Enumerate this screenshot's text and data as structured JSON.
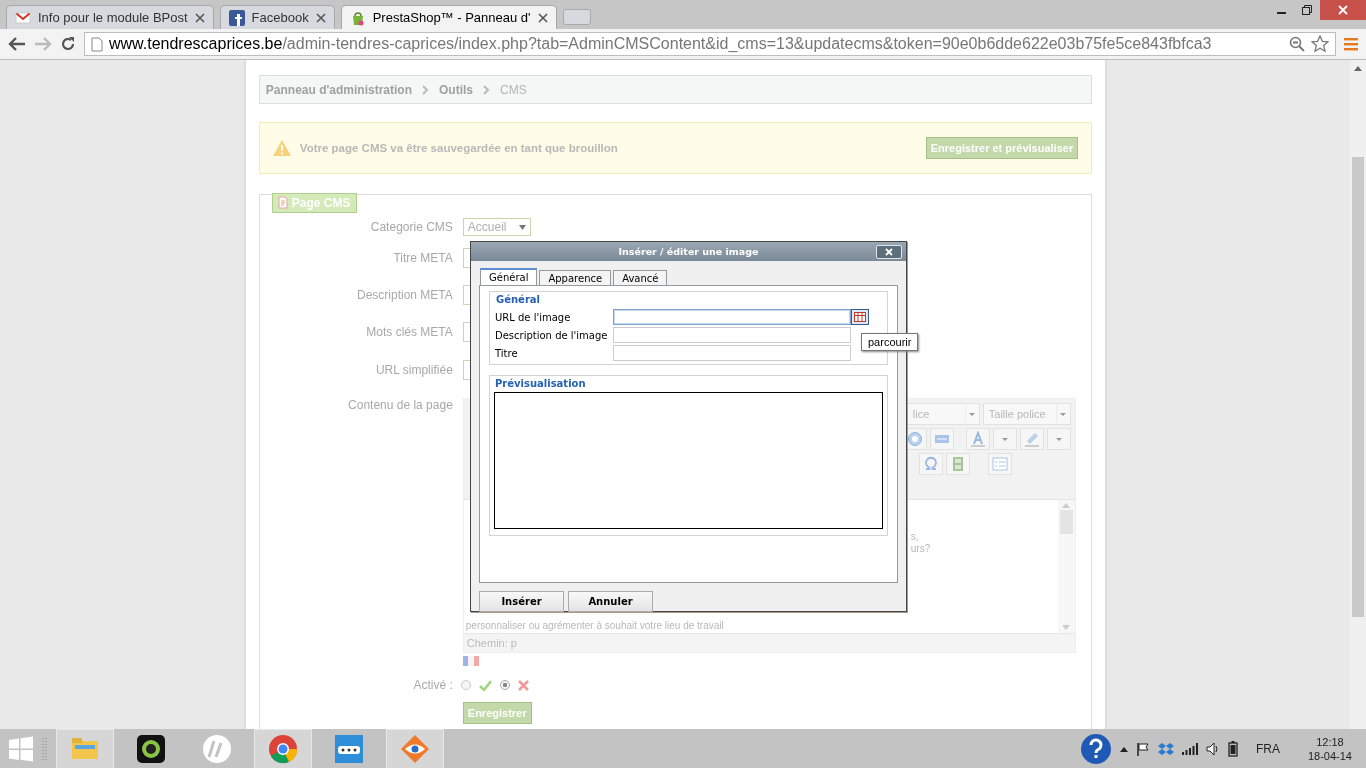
{
  "browser": {
    "tabs": [
      {
        "title": "Info pour le module BPost",
        "kind": "mail",
        "selected": false
      },
      {
        "title": "Facebook",
        "kind": "social",
        "selected": false
      },
      {
        "title": "PrestaShop™ - Panneau d'",
        "kind": "shop",
        "selected": true
      }
    ],
    "url": {
      "host": "www.tendrescaprices.be",
      "path": "/admin-tendres-caprices/index.php?tab=AdminCMSContent&id_cms=13&updatecms&token=90e0b6dde622e03b75fe5ce843fbfca3"
    }
  },
  "breadcrumb": [
    "Panneau d'administration",
    "Outils",
    "CMS"
  ],
  "warning": {
    "text": "Votre page CMS va être sauvegardée en tant que brouillon",
    "button": "Enregistrer et prévisualiser"
  },
  "form": {
    "legend": "Page CMS",
    "fields": [
      {
        "label": "Categorie CMS",
        "kind": "select",
        "value": "Accueil"
      },
      {
        "label": "Titre META",
        "kind": "text"
      },
      {
        "label": "Description META",
        "kind": "text"
      },
      {
        "label": "Mots clés META",
        "kind": "text"
      },
      {
        "label": "URL simplifiée",
        "kind": "text"
      },
      {
        "label": "Contenu de la page",
        "kind": "editor"
      }
    ],
    "editor": {
      "font_select": "lice",
      "size_select": "Taille police",
      "right_lines": [
        "s,",
        "urs?"
      ],
      "bottom_line": "personnaliser ou agrémenter à souhait votre lieu de travail",
      "path": "Chemin: p"
    },
    "active": {
      "label": "Activé :",
      "options": [
        {
          "kind": "yes",
          "selected": false
        },
        {
          "kind": "no",
          "selected": true
        }
      ]
    },
    "save_button": "Enregistrer"
  },
  "dialog": {
    "title": "Insérer / éditer une image",
    "tabs": [
      {
        "label": "Général",
        "selected": true
      },
      {
        "label": "Apparence",
        "selected": false
      },
      {
        "label": "Avancé",
        "selected": false
      }
    ],
    "general": {
      "legend": "Général",
      "fields": [
        {
          "label": "URL de l'image",
          "focused": true,
          "browse": true
        },
        {
          "label": "Description de l'image",
          "focused": false,
          "browse": false
        },
        {
          "label": "Titre",
          "focused": false,
          "browse": false
        }
      ]
    },
    "tooltip": "parcourir",
    "preview": {
      "legend": "Prévisualisation"
    },
    "buttons": [
      "Insérer",
      "Annuler"
    ]
  },
  "taskbar": {
    "apps": [
      {
        "kind": "folder",
        "running": true
      },
      {
        "kind": "camera",
        "running": false
      },
      {
        "kind": "hp",
        "running": false
      },
      {
        "kind": "chrome",
        "running": true
      },
      {
        "kind": "remote",
        "running": false
      },
      {
        "kind": "eye",
        "running": true
      }
    ],
    "language": "FRA",
    "time": "12:18",
    "date": "18-04-14"
  }
}
